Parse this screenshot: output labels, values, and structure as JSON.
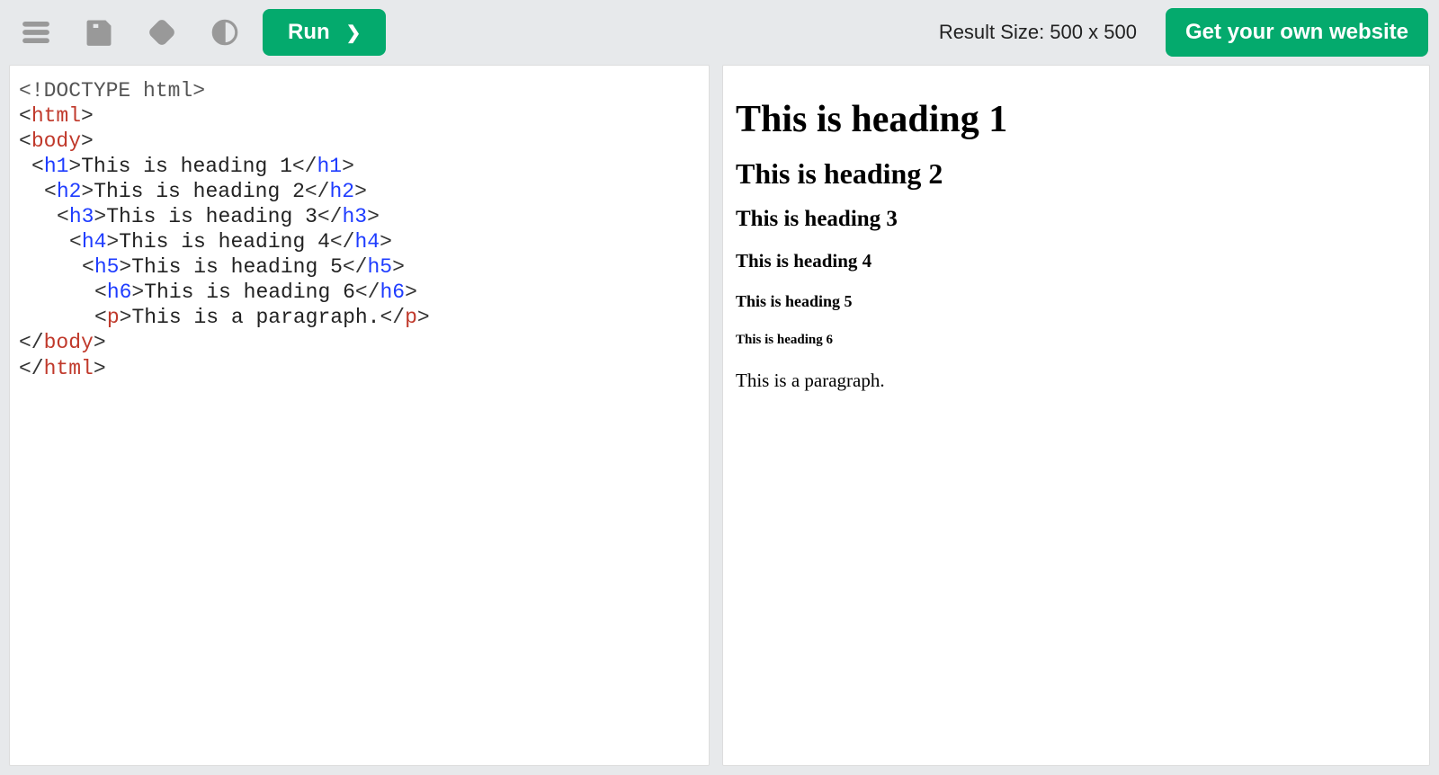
{
  "toolbar": {
    "run_label": "Run",
    "own_site_label": "Get your own website",
    "result_size_label": "Result Size: 500 x 500"
  },
  "editor": {
    "lines": [
      {
        "indent": 0,
        "tokens": [
          {
            "cls": "t-decl",
            "txt": "<!DOCTYPE html>"
          }
        ]
      },
      {
        "indent": 0,
        "tokens": [
          {
            "cls": "t-punct",
            "txt": "<"
          },
          {
            "cls": "t-tag",
            "txt": "html"
          },
          {
            "cls": "t-punct",
            "txt": ">"
          }
        ]
      },
      {
        "indent": 0,
        "tokens": [
          {
            "cls": "t-punct",
            "txt": "<"
          },
          {
            "cls": "t-tag",
            "txt": "body"
          },
          {
            "cls": "t-punct",
            "txt": ">"
          }
        ]
      },
      {
        "indent": 1,
        "tokens": [
          {
            "cls": "t-punct",
            "txt": "<"
          },
          {
            "cls": "t-htag",
            "txt": "h1"
          },
          {
            "cls": "t-punct",
            "txt": ">"
          },
          {
            "cls": "t-text",
            "txt": "This is heading 1"
          },
          {
            "cls": "t-punct",
            "txt": "</"
          },
          {
            "cls": "t-htag",
            "txt": "h1"
          },
          {
            "cls": "t-punct",
            "txt": ">"
          }
        ]
      },
      {
        "indent": 2,
        "tokens": [
          {
            "cls": "t-punct",
            "txt": "<"
          },
          {
            "cls": "t-htag",
            "txt": "h2"
          },
          {
            "cls": "t-punct",
            "txt": ">"
          },
          {
            "cls": "t-text",
            "txt": "This is heading 2"
          },
          {
            "cls": "t-punct",
            "txt": "</"
          },
          {
            "cls": "t-htag",
            "txt": "h2"
          },
          {
            "cls": "t-punct",
            "txt": ">"
          }
        ]
      },
      {
        "indent": 3,
        "tokens": [
          {
            "cls": "t-punct",
            "txt": "<"
          },
          {
            "cls": "t-htag",
            "txt": "h3"
          },
          {
            "cls": "t-punct",
            "txt": ">"
          },
          {
            "cls": "t-text",
            "txt": "This is heading 3"
          },
          {
            "cls": "t-punct",
            "txt": "</"
          },
          {
            "cls": "t-htag",
            "txt": "h3"
          },
          {
            "cls": "t-punct",
            "txt": ">"
          }
        ]
      },
      {
        "indent": 4,
        "tokens": [
          {
            "cls": "t-punct",
            "txt": "<"
          },
          {
            "cls": "t-htag",
            "txt": "h4"
          },
          {
            "cls": "t-punct",
            "txt": ">"
          },
          {
            "cls": "t-text",
            "txt": "This is heading 4"
          },
          {
            "cls": "t-punct",
            "txt": "</"
          },
          {
            "cls": "t-htag",
            "txt": "h4"
          },
          {
            "cls": "t-punct",
            "txt": ">"
          }
        ]
      },
      {
        "indent": 5,
        "tokens": [
          {
            "cls": "t-punct",
            "txt": "<"
          },
          {
            "cls": "t-htag",
            "txt": "h5"
          },
          {
            "cls": "t-punct",
            "txt": ">"
          },
          {
            "cls": "t-text",
            "txt": "This is heading 5"
          },
          {
            "cls": "t-punct",
            "txt": "</"
          },
          {
            "cls": "t-htag",
            "txt": "h5"
          },
          {
            "cls": "t-punct",
            "txt": ">"
          }
        ]
      },
      {
        "indent": 6,
        "tokens": [
          {
            "cls": "t-punct",
            "txt": "<"
          },
          {
            "cls": "t-htag",
            "txt": "h6"
          },
          {
            "cls": "t-punct",
            "txt": ">"
          },
          {
            "cls": "t-text",
            "txt": "This is heading 6"
          },
          {
            "cls": "t-punct",
            "txt": "</"
          },
          {
            "cls": "t-htag",
            "txt": "h6"
          },
          {
            "cls": "t-punct",
            "txt": ">"
          }
        ]
      },
      {
        "indent": 6,
        "tokens": [
          {
            "cls": "t-punct",
            "txt": "<"
          },
          {
            "cls": "t-tag",
            "txt": "p"
          },
          {
            "cls": "t-punct",
            "txt": ">"
          },
          {
            "cls": "t-text",
            "txt": "This is a paragraph."
          },
          {
            "cls": "t-punct",
            "txt": "</"
          },
          {
            "cls": "t-tag",
            "txt": "p"
          },
          {
            "cls": "t-punct",
            "txt": ">"
          }
        ]
      },
      {
        "indent": 0,
        "tokens": [
          {
            "cls": "t-punct",
            "txt": "</"
          },
          {
            "cls": "t-tag",
            "txt": "body"
          },
          {
            "cls": "t-punct",
            "txt": ">"
          }
        ]
      },
      {
        "indent": 0,
        "tokens": [
          {
            "cls": "t-punct",
            "txt": "</"
          },
          {
            "cls": "t-tag",
            "txt": "html"
          },
          {
            "cls": "t-punct",
            "txt": ">"
          }
        ]
      }
    ]
  },
  "preview": {
    "h1": "This is heading 1",
    "h2": "This is heading 2",
    "h3": "This is heading 3",
    "h4": "This is heading 4",
    "h5": "This is heading 5",
    "h6": "This is heading 6",
    "p": "This is a paragraph."
  }
}
